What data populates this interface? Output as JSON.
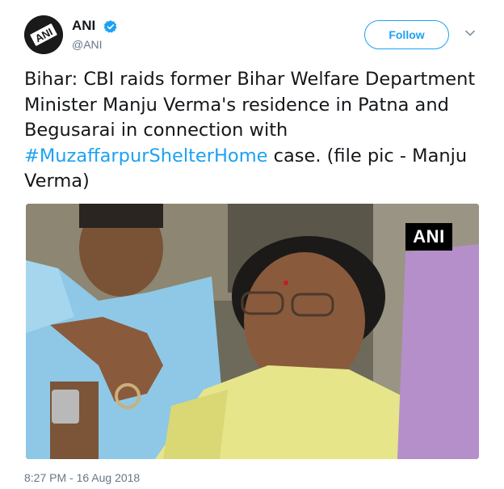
{
  "header": {
    "display_name": "ANI",
    "handle": "@ANI",
    "follow_label": "Follow",
    "avatar_text": "ANI"
  },
  "tweet": {
    "text_before": "Bihar: CBI raids former Bihar Welfare Department Minister Manju Verma's residence in Patna and Begusarai in connection with ",
    "hashtag": "#MuzaffarpurShelterHome",
    "text_after": " case. (file pic - Manju Verma)"
  },
  "media": {
    "watermark": "ANI"
  },
  "footer": {
    "timestamp": "8:27 PM - 16 Aug 2018"
  },
  "colors": {
    "accent": "#1da1f2",
    "text": "#14171a",
    "muted": "#657786"
  },
  "icons": {
    "verified": "verified-badge-icon",
    "caret": "chevron-down-icon"
  }
}
